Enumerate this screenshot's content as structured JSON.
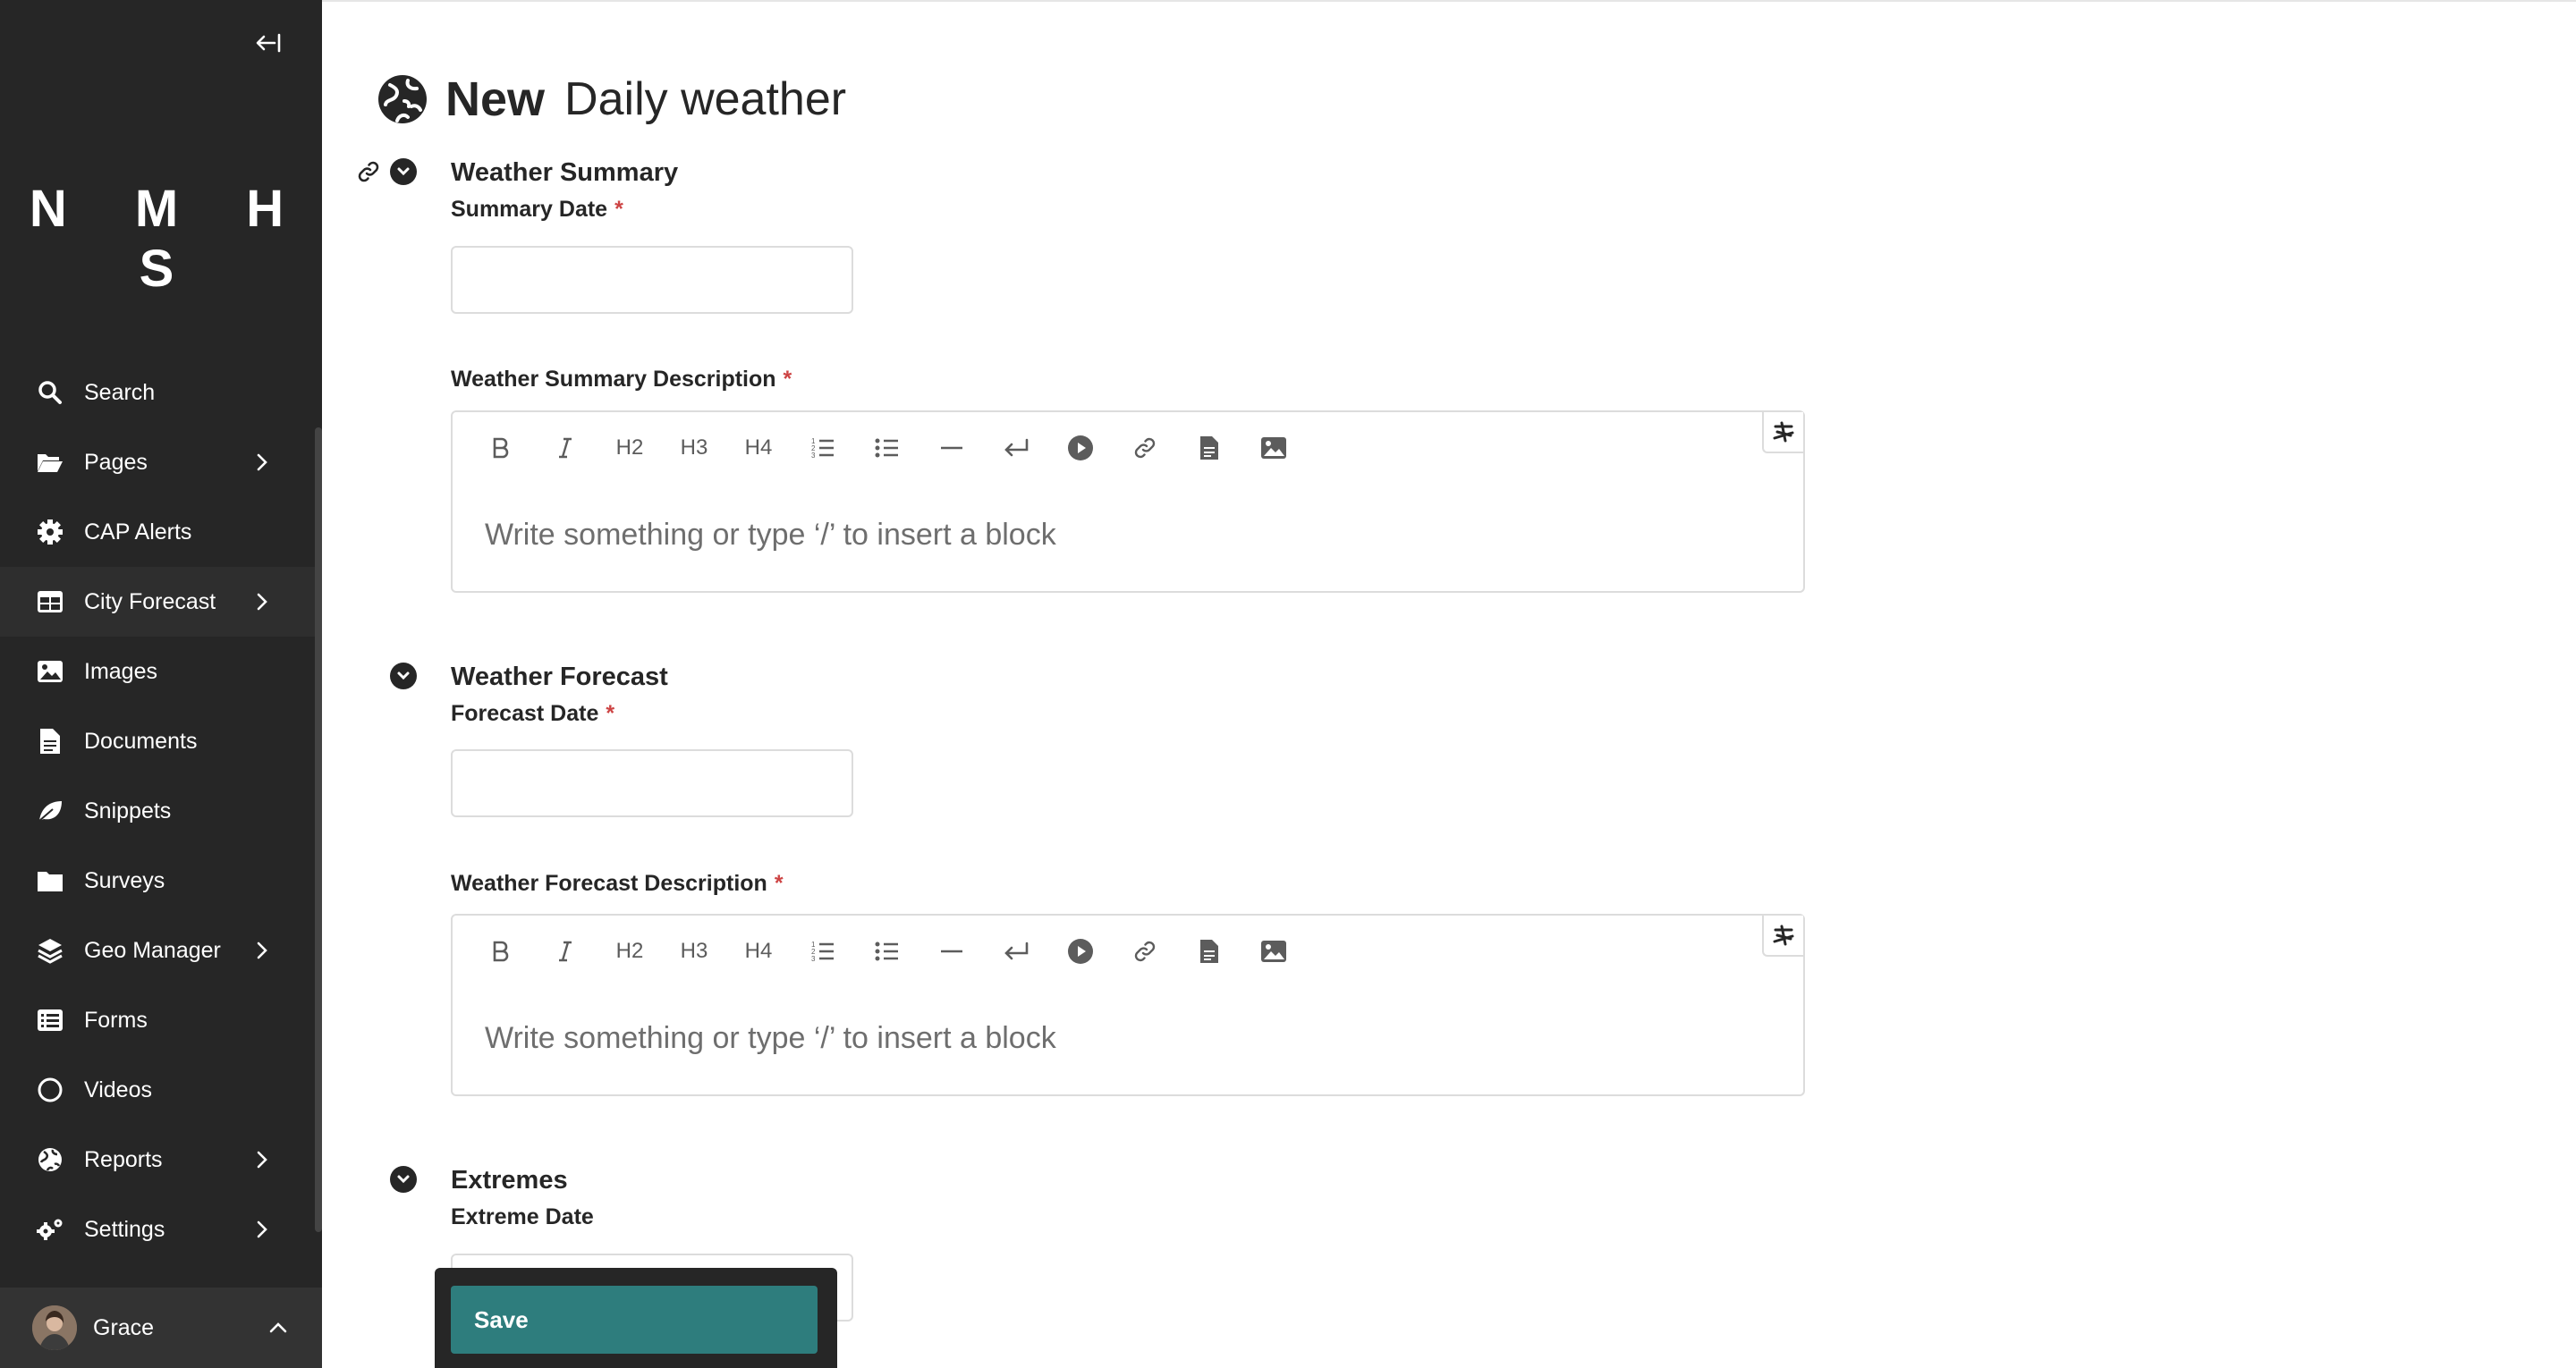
{
  "sidebar": {
    "logo": "N M H S",
    "items": [
      {
        "label": "Search",
        "icon": "search-icon",
        "has_submenu": false
      },
      {
        "label": "Pages",
        "icon": "folder-open-icon",
        "has_submenu": true
      },
      {
        "label": "CAP Alerts",
        "icon": "gear-icon",
        "has_submenu": false
      },
      {
        "label": "City Forecast",
        "icon": "table-icon",
        "has_submenu": true,
        "active": true
      },
      {
        "label": "Images",
        "icon": "image-icon",
        "has_submenu": false
      },
      {
        "label": "Documents",
        "icon": "document-icon",
        "has_submenu": false
      },
      {
        "label": "Snippets",
        "icon": "leaf-icon",
        "has_submenu": false
      },
      {
        "label": "Surveys",
        "icon": "folder-icon",
        "has_submenu": false
      },
      {
        "label": "Geo Manager",
        "icon": "layers-icon",
        "has_submenu": true
      },
      {
        "label": "Forms",
        "icon": "list-icon",
        "has_submenu": false
      },
      {
        "label": "Videos",
        "icon": "circle-icon",
        "has_submenu": false
      },
      {
        "label": "Reports",
        "icon": "globe-icon",
        "has_submenu": true
      },
      {
        "label": "Settings",
        "icon": "cogs-icon",
        "has_submenu": true
      }
    ],
    "user": {
      "name": "Grace"
    }
  },
  "header": {
    "prefix": "New",
    "title": "Daily weather"
  },
  "sections": {
    "summary": {
      "title": "Weather Summary",
      "date_label": "Summary Date",
      "desc_label": "Weather Summary Description",
      "placeholder": "Write something or type ‘/’ to insert a block"
    },
    "forecast": {
      "title": "Weather Forecast",
      "date_label": "Forecast Date",
      "desc_label": "Weather Forecast Description",
      "placeholder": "Write something or type ‘/’ to insert a block"
    },
    "extremes": {
      "title": "Extremes",
      "date_label": "Extreme Date"
    }
  },
  "required_mark": "*",
  "toolbar": {
    "h2": "H2",
    "h3": "H3",
    "h4": "H4"
  },
  "footer": {
    "save_label": "Save"
  },
  "colors": {
    "sidebar_bg": "#262626",
    "accent": "#2e7d7d",
    "required": "#cd4444"
  }
}
